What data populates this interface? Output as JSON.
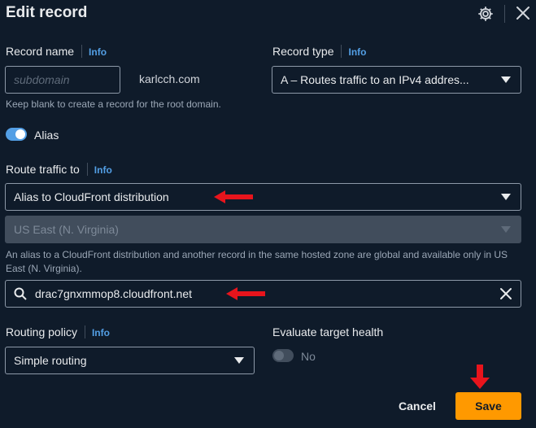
{
  "header": {
    "title": "Edit record"
  },
  "record_name": {
    "label": "Record name",
    "info": "Info",
    "placeholder": "subdomain",
    "domain_suffix": "karlcch.com",
    "hint": "Keep blank to create a record for the root domain."
  },
  "record_type": {
    "label": "Record type",
    "info": "Info",
    "value": "A – Routes traffic to an IPv4 addres..."
  },
  "alias": {
    "label": "Alias",
    "enabled": true
  },
  "route_traffic": {
    "label": "Route traffic to",
    "info": "Info",
    "endpoint_value": "Alias to CloudFront distribution",
    "region_value": "US East (N. Virginia)",
    "hint": "An alias to a CloudFront distribution and another record in the same hosted zone are global and available only in US East (N. Virginia).",
    "target_value": "drac7gnxmmop8.cloudfront.net"
  },
  "routing_policy": {
    "label": "Routing policy",
    "info": "Info",
    "value": "Simple routing"
  },
  "target_health": {
    "label": "Evaluate target health",
    "toggle_label": "No",
    "enabled": false
  },
  "footer": {
    "cancel_label": "Cancel",
    "save_label": "Save"
  },
  "colors": {
    "accent": "#539fe5",
    "primary_button": "#ff9900",
    "annotation_arrow": "#e8141c",
    "background": "#0f1b2a"
  }
}
